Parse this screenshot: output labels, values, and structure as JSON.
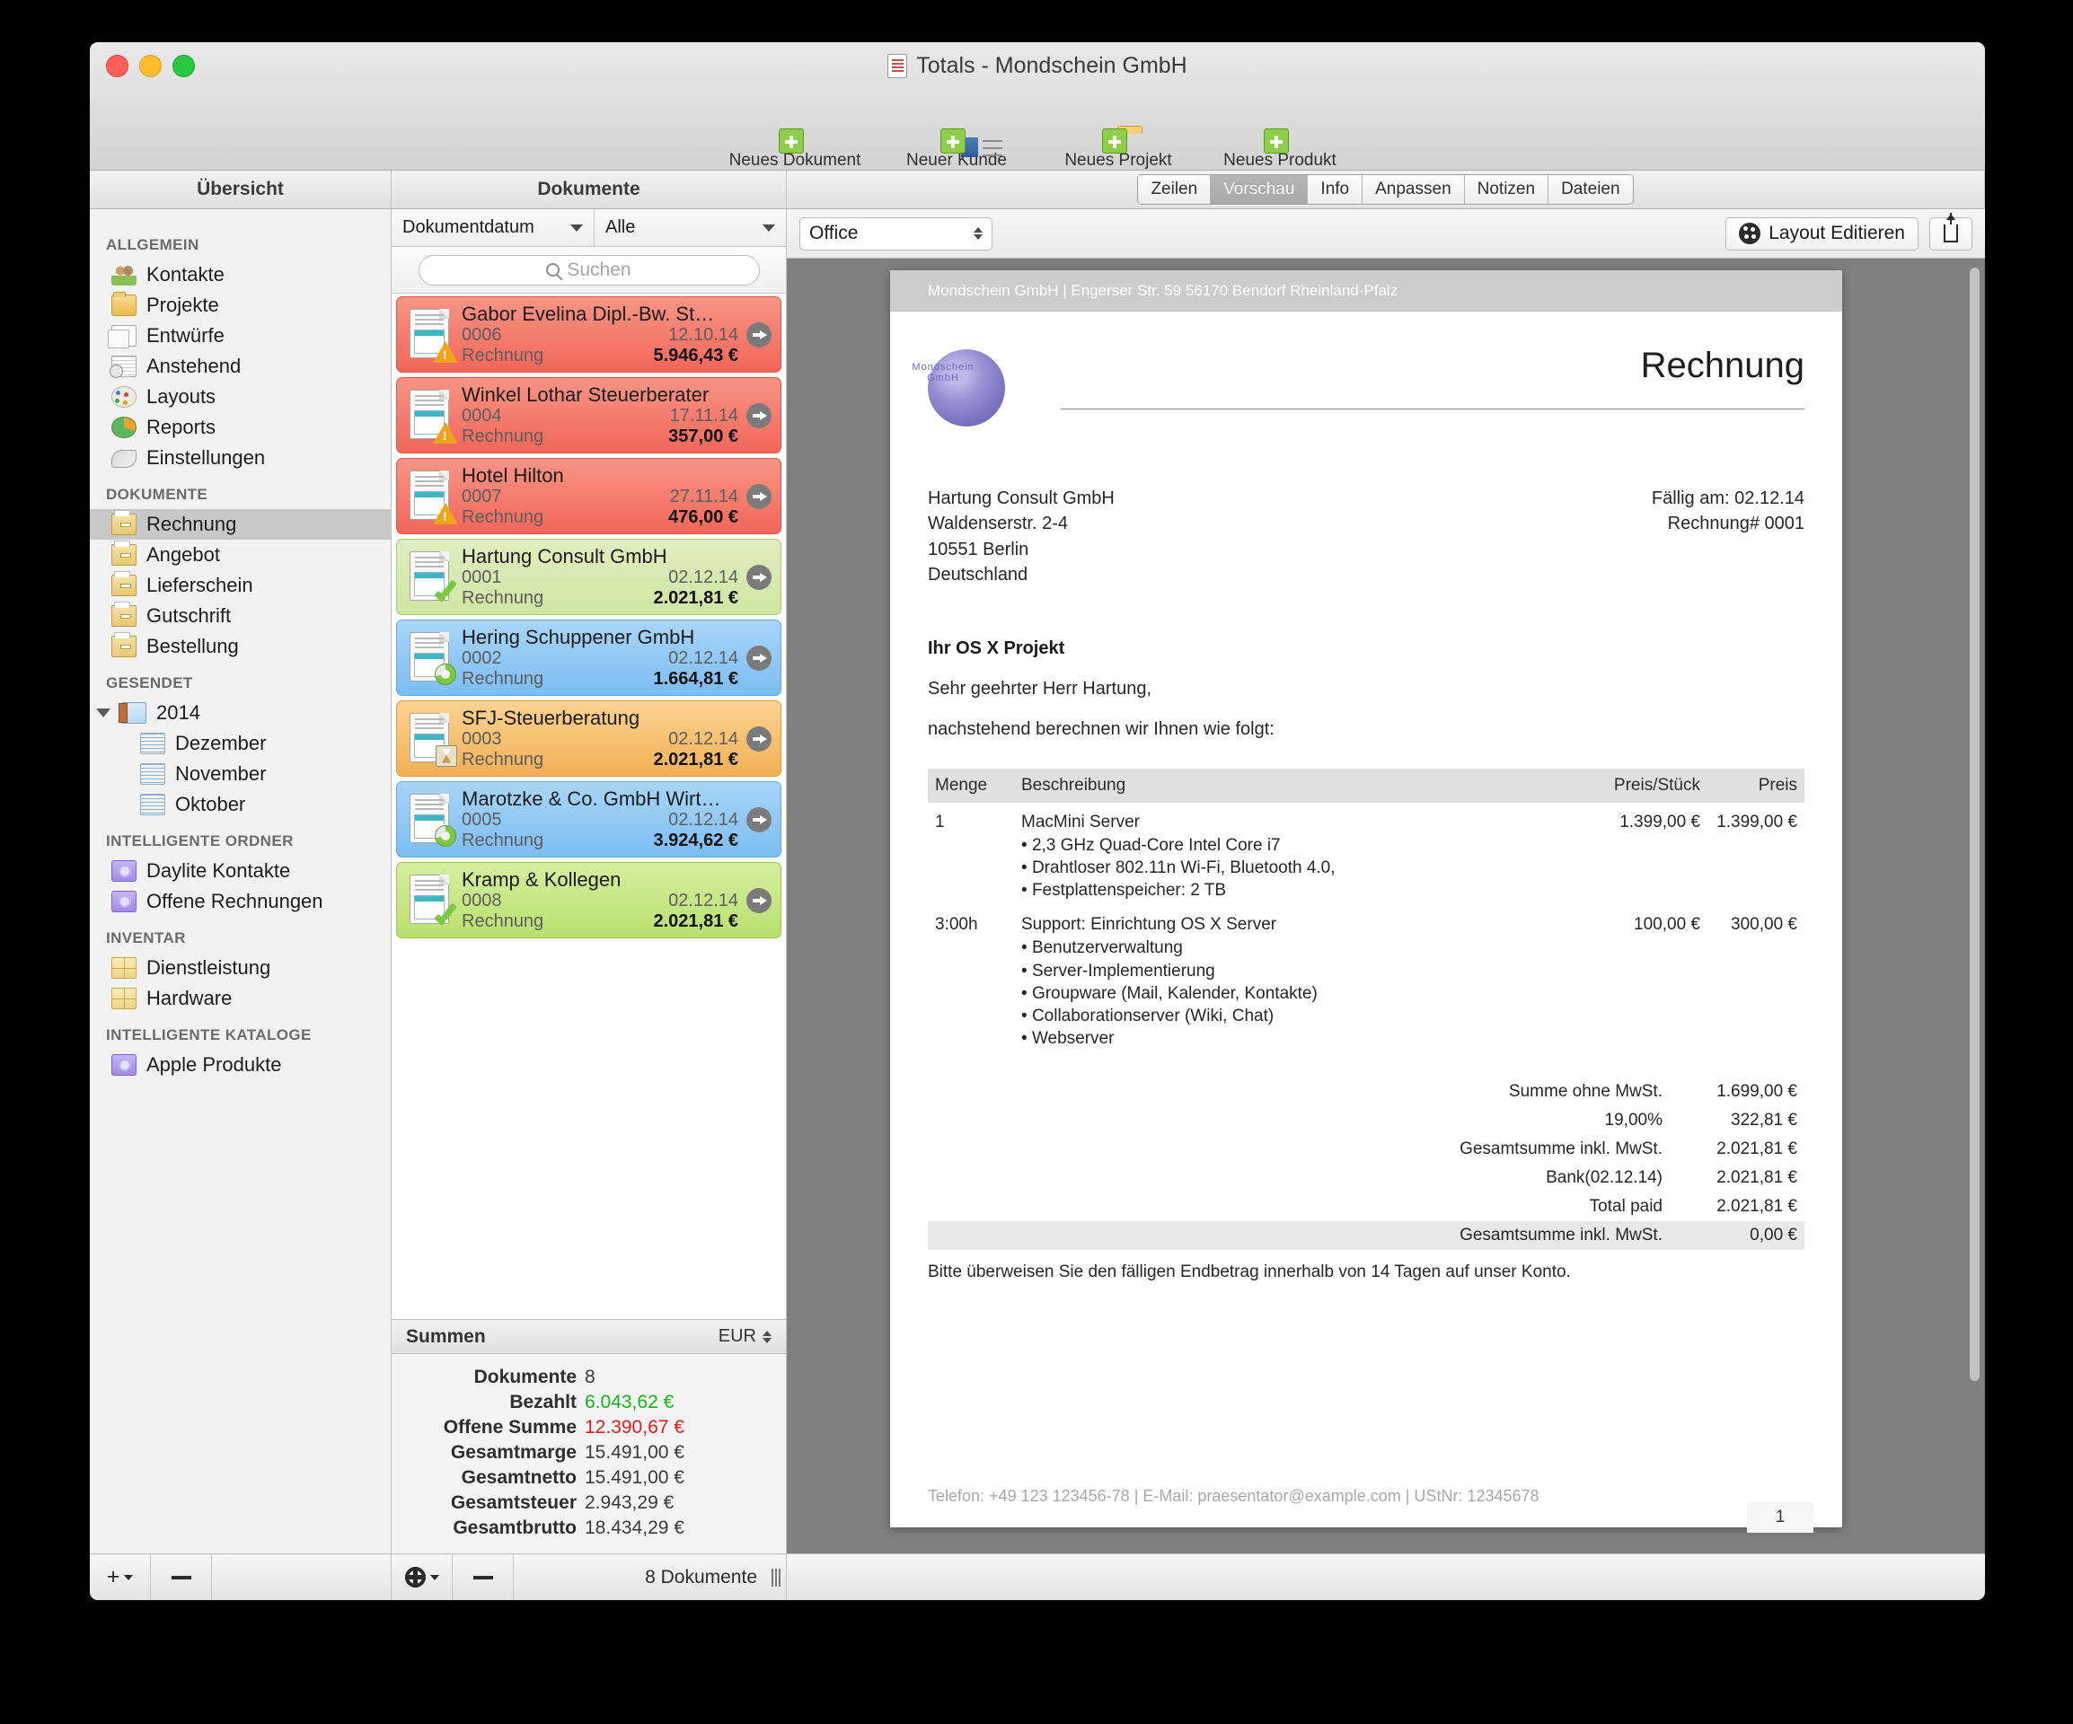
{
  "window": {
    "title": "Totals - Mondschein GmbH",
    "traffic": [
      "close",
      "minimize",
      "zoom"
    ]
  },
  "toolbar": {
    "items": [
      {
        "label": "Neues Dokument",
        "icon": "new-document-icon"
      },
      {
        "label": "Neuer Kunde",
        "icon": "new-customer-icon"
      },
      {
        "label": "Neues Projekt",
        "icon": "new-project-icon"
      },
      {
        "label": "Neues Produkt",
        "icon": "new-product-icon"
      }
    ]
  },
  "columns": {
    "overview_header": "Übersicht",
    "documents_header": "Dokumente"
  },
  "tabs": [
    {
      "label": "Zeilen",
      "active": false
    },
    {
      "label": "Vorschau",
      "active": true
    },
    {
      "label": "Info",
      "active": false
    },
    {
      "label": "Anpassen",
      "active": false
    },
    {
      "label": "Notizen",
      "active": false
    },
    {
      "label": "Dateien",
      "active": false
    }
  ],
  "sidebar": {
    "groups": [
      {
        "title": "ALLGEMEIN",
        "items": [
          {
            "label": "Kontakte",
            "icon": "people-icon",
            "selected": false
          },
          {
            "label": "Projekte",
            "icon": "folder-icon",
            "selected": false
          },
          {
            "label": "Entwürfe",
            "icon": "copy-icon",
            "selected": false
          },
          {
            "label": "Anstehend",
            "icon": "pending-clock-icon",
            "selected": false
          },
          {
            "label": "Layouts",
            "icon": "palette-icon",
            "selected": false
          },
          {
            "label": "Reports",
            "icon": "pie-chart-icon",
            "selected": false
          },
          {
            "label": "Einstellungen",
            "icon": "wrench-icon",
            "selected": false
          }
        ]
      },
      {
        "title": "DOKUMENTE",
        "items": [
          {
            "label": "Rechnung",
            "icon": "invoice-icon",
            "selected": true
          },
          {
            "label": "Angebot",
            "icon": "invoice-icon",
            "selected": false
          },
          {
            "label": "Lieferschein",
            "icon": "invoice-icon",
            "selected": false
          },
          {
            "label": "Gutschrift",
            "icon": "invoice-icon",
            "selected": false
          },
          {
            "label": "Bestellung",
            "icon": "invoice-icon",
            "selected": false
          }
        ]
      },
      {
        "title": "GESENDET",
        "items": [
          {
            "label": "2014",
            "icon": "year-book-icon",
            "selected": false,
            "expanded": true
          },
          {
            "label": "Dezember",
            "icon": "month-docs-icon",
            "selected": false,
            "sub": true
          },
          {
            "label": "November",
            "icon": "month-docs-icon",
            "selected": false,
            "sub": true
          },
          {
            "label": "Oktober",
            "icon": "month-docs-icon",
            "selected": false,
            "sub": true
          }
        ]
      },
      {
        "title": "INTELLIGENTE ORDNER",
        "items": [
          {
            "label": "Daylite Kontakte",
            "icon": "smart-folder-icon",
            "selected": false
          },
          {
            "label": "Offene Rechnungen",
            "icon": "smart-folder-icon",
            "selected": false
          }
        ]
      },
      {
        "title": "INVENTAR",
        "items": [
          {
            "label": "Dienstleistung",
            "icon": "inventory-icon",
            "selected": false
          },
          {
            "label": "Hardware",
            "icon": "inventory-icon",
            "selected": false
          }
        ]
      },
      {
        "title": "INTELLIGENTE KATALOGE",
        "items": [
          {
            "label": "Apple Produkte",
            "icon": "smart-folder-icon",
            "selected": false
          }
        ]
      }
    ]
  },
  "doclist": {
    "sort_filter": "Dokumentdatum",
    "status_filter": "Alle",
    "search_placeholder": "Suchen",
    "rows": [
      {
        "name": "Gabor Evelina Dipl.-Bw. St…",
        "number": "0006",
        "date": "12.10.14",
        "type": "Rechnung",
        "amount": "5.946,43 €",
        "color": "red",
        "status": "overdue"
      },
      {
        "name": "Winkel Lothar Steuerberater",
        "number": "0004",
        "date": "17.11.14",
        "type": "Rechnung",
        "amount": "357,00 €",
        "color": "red",
        "status": "overdue"
      },
      {
        "name": "Hotel Hilton",
        "number": "0007",
        "date": "27.11.14",
        "type": "Rechnung",
        "amount": "476,00 €",
        "color": "red",
        "status": "overdue"
      },
      {
        "name": "Hartung Consult GmbH",
        "number": "0001",
        "date": "02.12.14",
        "type": "Rechnung",
        "amount": "2.021,81 €",
        "color": "green",
        "status": "paid"
      },
      {
        "name": "Hering Schuppener GmbH",
        "number": "0002",
        "date": "02.12.14",
        "type": "Rechnung",
        "amount": "1.664,81 €",
        "color": "blue",
        "status": "partial"
      },
      {
        "name": "SFJ-Steuerberatung",
        "number": "0003",
        "date": "02.12.14",
        "type": "Rechnung",
        "amount": "2.021,81 €",
        "color": "orange",
        "status": "pending"
      },
      {
        "name": "Marotzke & Co. GmbH Wirt…",
        "number": "0005",
        "date": "02.12.14",
        "type": "Rechnung",
        "amount": "3.924,62 €",
        "color": "blue2",
        "status": "partial"
      },
      {
        "name": "Kramp & Kollegen",
        "number": "0008",
        "date": "02.12.14",
        "type": "Rechnung",
        "amount": "2.021,81 €",
        "color": "green2",
        "status": "paid"
      }
    ]
  },
  "summen": {
    "title": "Summen",
    "currency": "EUR",
    "lines": [
      {
        "label": "Dokumente",
        "value": "8",
        "tone": "normal"
      },
      {
        "label": "Bezahlt",
        "value": "6.043,62 €",
        "tone": "green"
      },
      {
        "label": "Offene Summe",
        "value": "12.390,67 €",
        "tone": "red"
      },
      {
        "label": "Gesamtmarge",
        "value": "15.491,00 €",
        "tone": "normal"
      },
      {
        "label": "Gesamtnetto",
        "value": "15.491,00 €",
        "tone": "normal"
      },
      {
        "label": "Gesamtsteuer",
        "value": "2.943,29 €",
        "tone": "normal"
      },
      {
        "label": "Gesamtbrutto",
        "value": "18.434,29 €",
        "tone": "normal"
      }
    ]
  },
  "preview_toolbar": {
    "layout_select": "Office",
    "edit_layout_label": "Layout Editieren",
    "share_icon": "share-icon"
  },
  "invoice": {
    "header_line": "Mondschein GmbH | Engerser Str. 59 56170 Bendorf Rheinland-Pfalz",
    "logo_text": "Mondschein GmbH",
    "title": "Rechnung",
    "recipient": [
      "Hartung Consult GmbH",
      "Waldenserstr. 2-4",
      "10551 Berlin",
      "Deutschland"
    ],
    "meta": [
      "Fällig am: 02.12.14",
      "Rechnung# 0001"
    ],
    "subject": "Ihr OS X Projekt",
    "salutation": "Sehr geehrter Herr Hartung,",
    "intro": "nachstehend berechnen wir Ihnen wie folgt:",
    "table_headers": [
      "Menge",
      "Beschreibung",
      "Preis/Stück",
      "Preis"
    ],
    "items": [
      {
        "qty": "1",
        "desc": "MacMini Server",
        "bullets": [
          "2,3 GHz Quad-Core Intel Core i7",
          "Drahtloser 802.11n Wi-Fi, Bluetooth 4.0,",
          "Festplattenspeicher: 2 TB"
        ],
        "unit_price": "1.399,00 €",
        "price": "1.399,00 €"
      },
      {
        "qty": "3:00h",
        "desc": "Support: Einrichtung OS X Server",
        "bullets": [
          "Benutzerverwaltung",
          "Server-Implementierung",
          "Groupware (Mail, Kalender, Kontakte)",
          "Collaborationserver (Wiki, Chat)",
          "Webserver"
        ],
        "unit_price": "100,00 €",
        "price": "300,00 €"
      }
    ],
    "totals": [
      {
        "label": "Summe ohne MwSt.",
        "value": "1.699,00 €",
        "highlight": false
      },
      {
        "label": "19,00%",
        "value": "322,81 €",
        "highlight": false
      },
      {
        "label": "Gesamtsumme inkl. MwSt.",
        "value": "2.021,81 €",
        "highlight": false
      },
      {
        "label": "Bank(02.12.14)",
        "value": "2.021,81 €",
        "highlight": false
      },
      {
        "label": "Total paid",
        "value": "2.021,81 €",
        "highlight": false
      },
      {
        "label": "Gesamtsumme inkl. MwSt.",
        "value": "0,00 €",
        "highlight": true
      }
    ],
    "note": "Bitte überweisen Sie den fälligen Endbetrag innerhalb von 14 Tagen auf unser Konto.",
    "footer": "Telefon: +49 123 123456-78  |  E-Mail:  praesentator@example.com  |  UStNr: 12345678",
    "page_number": "1"
  },
  "footer": {
    "add_label": "+",
    "remove_label": "−",
    "gear_icon": "gear-icon",
    "count_label": "8 Dokumente"
  },
  "colors": {
    "accent_selected": "#c8c8c8",
    "paid_green": "#17b317",
    "open_red": "#e01b1b",
    "row_red": "#f2665a",
    "row_green": "#cfe5a3",
    "row_blue": "#7cbdf2",
    "row_orange": "#f3b055",
    "row_green2": "#b9e06e"
  }
}
